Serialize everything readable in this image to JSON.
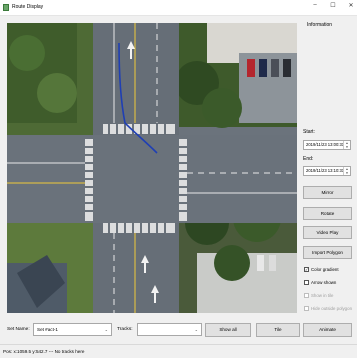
{
  "window": {
    "title": "Route Display",
    "controls": [
      "–",
      "☐",
      "✕"
    ]
  },
  "panel": {
    "info_label": "Information",
    "start_label": "Start:",
    "start_value": "2019/11/23 13:00:31",
    "end_label": "End:",
    "end_value": "2019/11/23 13:10:31",
    "buttons": {
      "mirror": "Mirror",
      "rotate": "Rotate",
      "video_play": "Video Play",
      "import_polygon": "Import Polygon"
    },
    "checkboxes": {
      "color_gradient": {
        "label": "Color gradient",
        "checked": true
      },
      "arrow_shown": {
        "label": "Arrow shown",
        "checked": false
      },
      "show_in_tile": {
        "label": "Show in tile",
        "checked": false
      },
      "hide_outside_polygon": {
        "label": "Hide outside polygon",
        "checked": false
      }
    }
  },
  "bottom": {
    "set_name_label": "Set Name:",
    "set_name_value": "Set #act-1",
    "tracks_label": "Tracks:",
    "tracks_value": "",
    "show_all": "Show all",
    "tile": "Tile",
    "animate": "Animate"
  },
  "status": {
    "text": "Pos: x:1059.5 y:542.7 --- No tracks here"
  },
  "colors": {
    "track": "#1f3fb4",
    "road": "#5f666f",
    "grass": "#4c6b2f",
    "roof": "#e6e4df"
  }
}
